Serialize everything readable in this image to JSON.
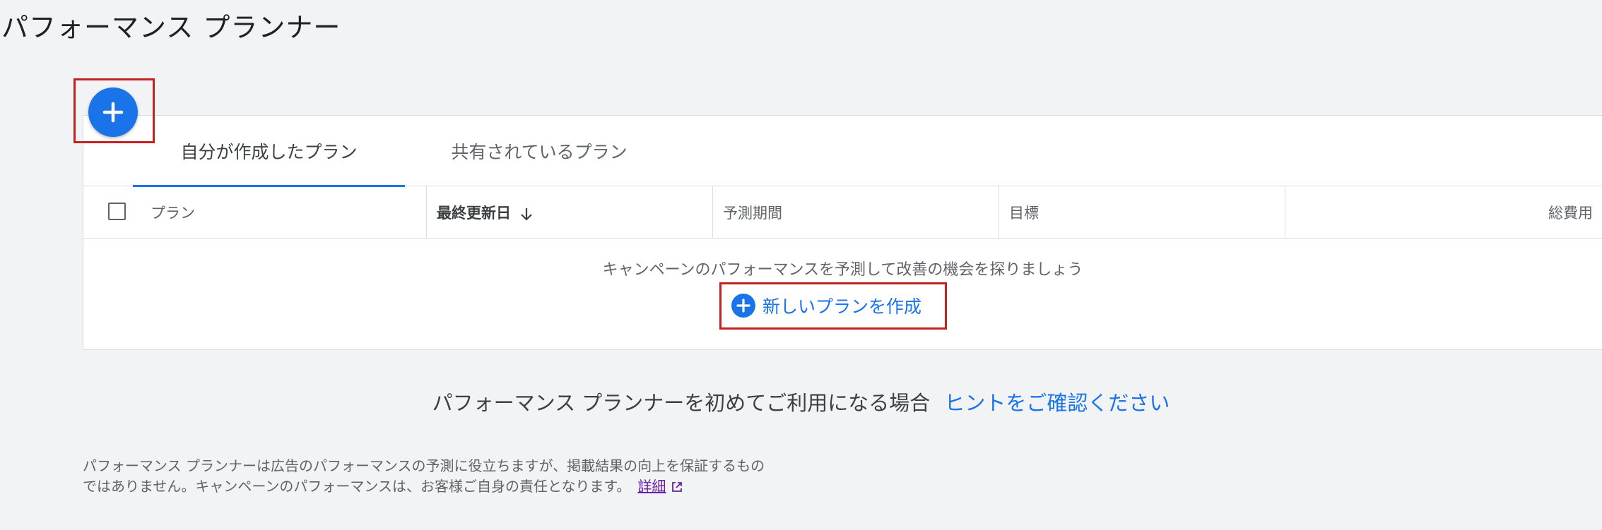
{
  "page": {
    "title": "パフォーマンス プランナー"
  },
  "tabs": [
    {
      "label": "自分が作成したプラン",
      "active": true
    },
    {
      "label": "共有されているプラン",
      "active": false
    }
  ],
  "table": {
    "columns": {
      "plan": "プラン",
      "last_updated": "最終更新日",
      "forecast_period": "予測期間",
      "target": "目標",
      "total_cost": "総費用"
    },
    "sort_icon": "arrow-down-icon"
  },
  "empty_state": {
    "message": "キャンペーンのパフォーマンスを予測して改善の機会を探りましょう",
    "new_plan_label": "新しいプランを作成",
    "icon": "plus-icon"
  },
  "hint": {
    "text": "パフォーマンス プランナーを初めてご利用になる場合",
    "link": "ヒントをご確認ください"
  },
  "disclaimer": {
    "line1": "パフォーマンス プランナーは広告のパフォーマンスの予測に役立ちますが、掲載結果の向上を保証するもの",
    "line2": "ではありません。キャンペーンのパフォーマンスは、お客様ご自身の責任となります。",
    "details_link": "詳細",
    "icon": "external-link-icon"
  },
  "colors": {
    "accent": "#1a73e8",
    "highlight": "#c5221f",
    "visited_link": "#681da8",
    "background": "#f1f3f4"
  }
}
